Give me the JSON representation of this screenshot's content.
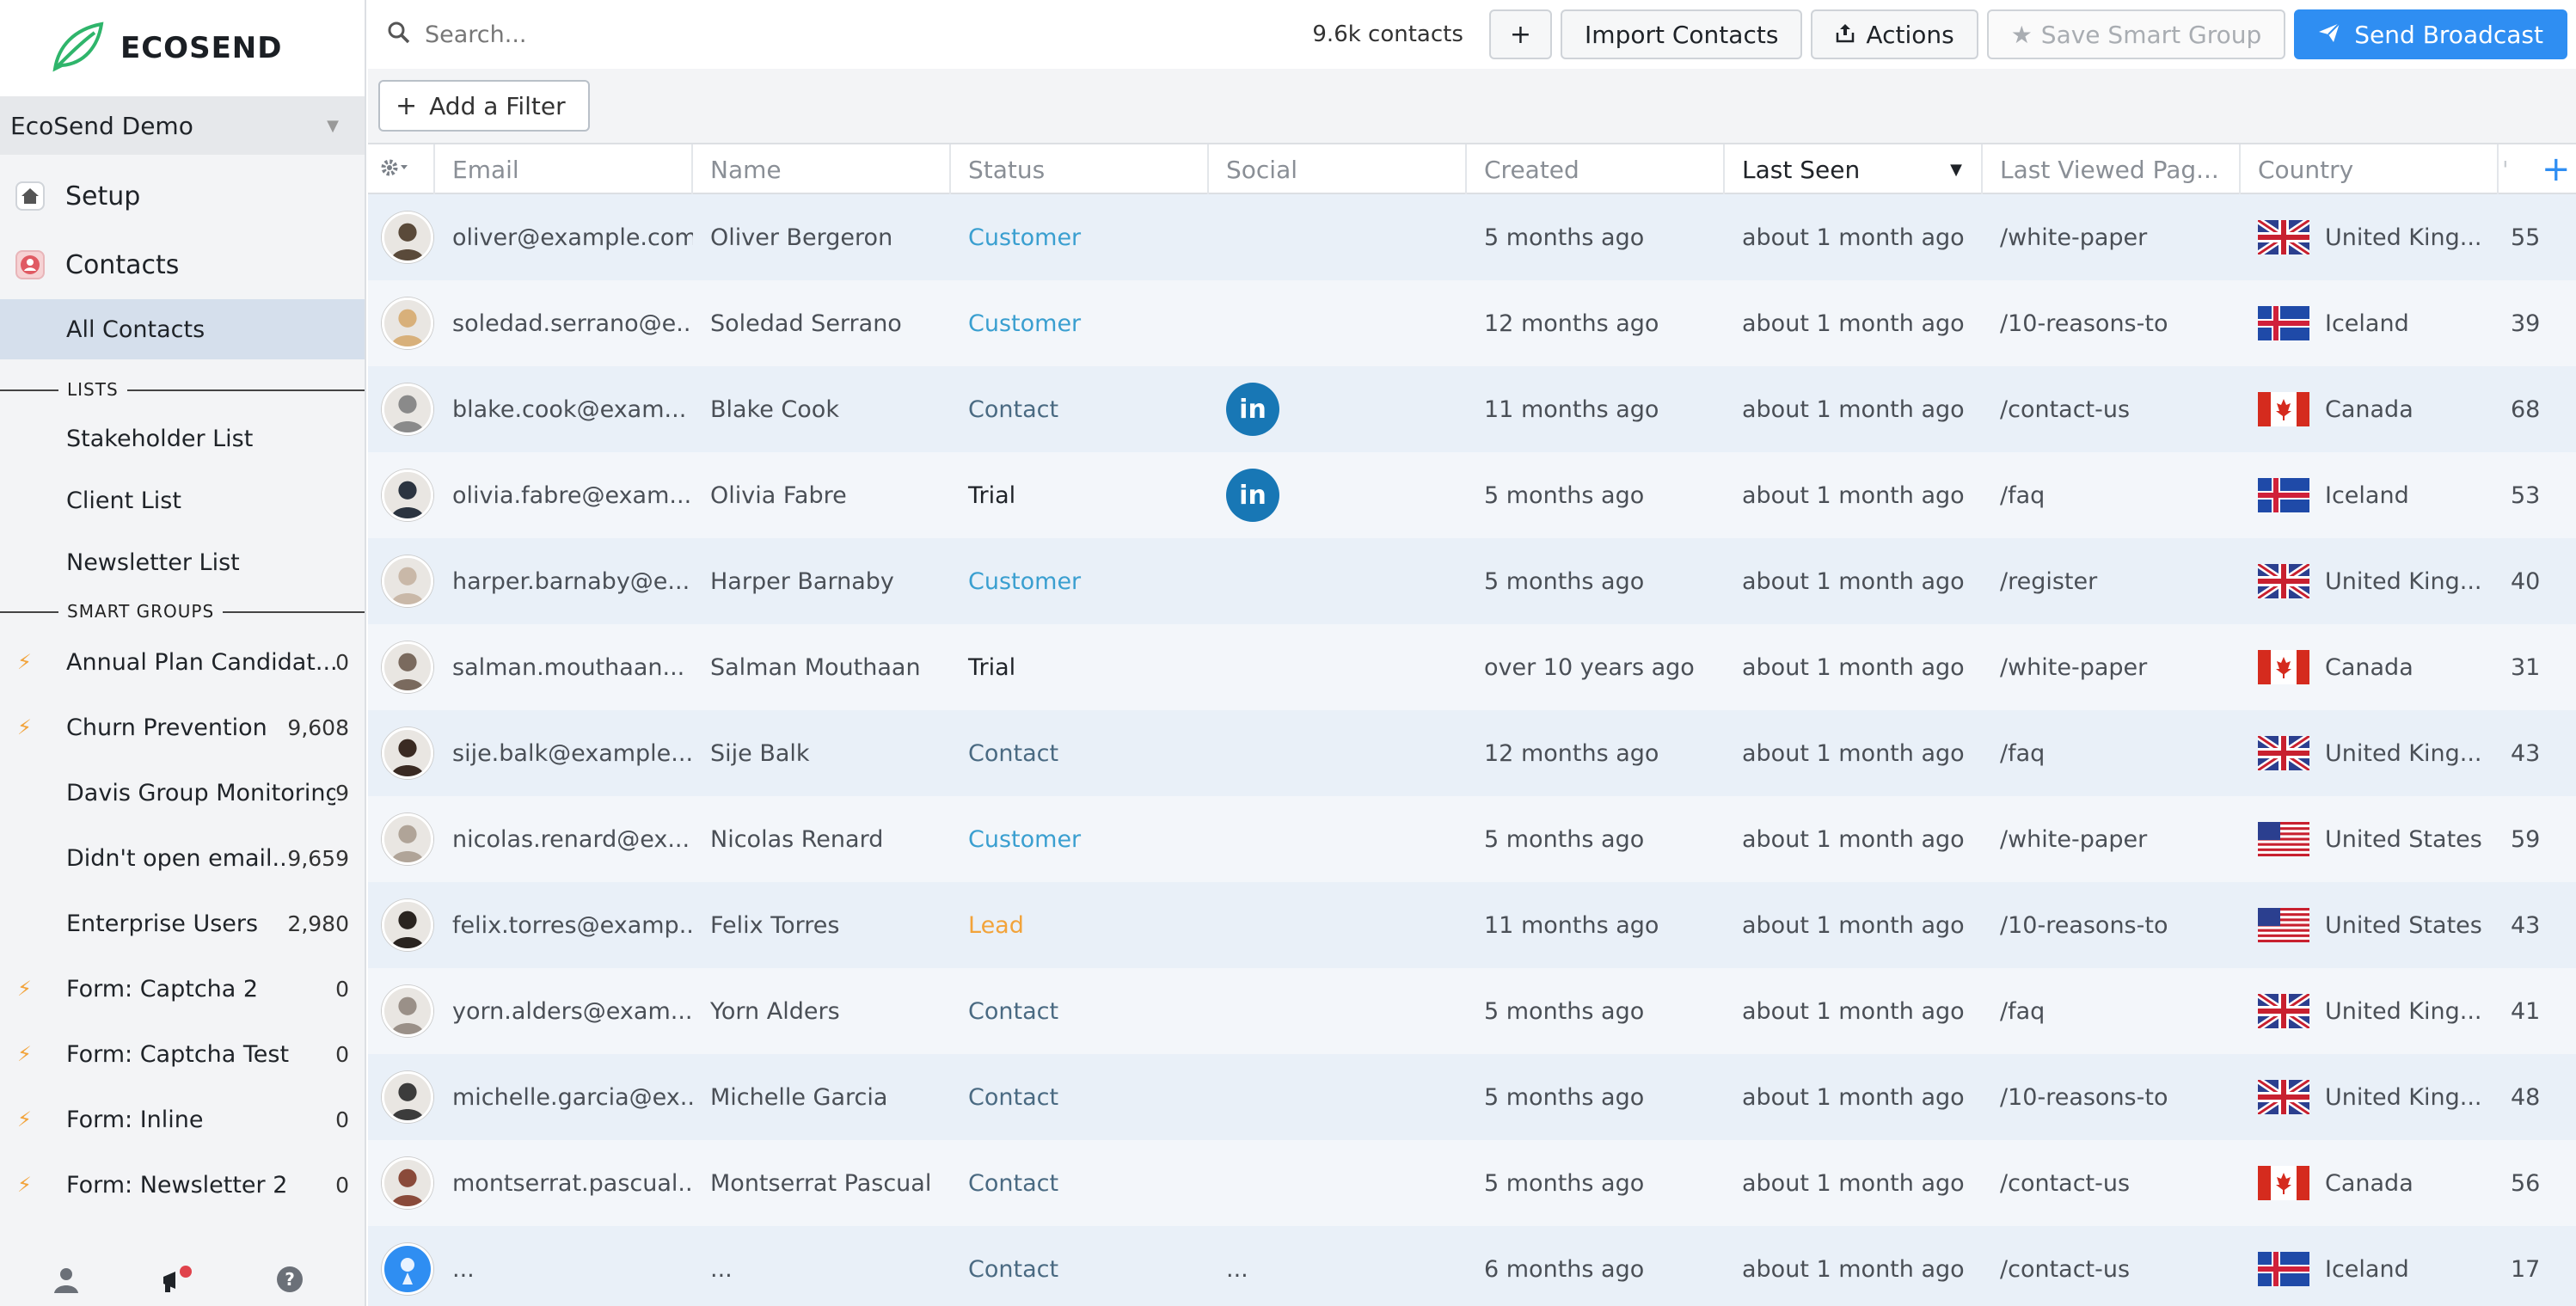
{
  "app": {
    "brand": "ECOSEND",
    "workspace": "EcoSend Demo"
  },
  "sidebar": {
    "nav": [
      {
        "label": "Setup",
        "icon": "house-icon"
      },
      {
        "label": "Contacts",
        "icon": "contacts-icon"
      }
    ],
    "all_contacts": "All Contacts",
    "lists_heading": "LISTS",
    "lists": [
      "Stakeholder List",
      "Client List",
      "Newsletter List"
    ],
    "smart_groups_heading": "SMART GROUPS",
    "smart_groups": [
      {
        "name": "Annual Plan Candidat...",
        "count": "0",
        "bolt": true
      },
      {
        "name": "Churn Prevention",
        "count": "9,608",
        "bolt": true
      },
      {
        "name": "Davis Group Monitoring",
        "count": "9",
        "bolt": false
      },
      {
        "name": "Didn't open email...",
        "count": "9,659",
        "bolt": false
      },
      {
        "name": "Enterprise Users",
        "count": "2,980",
        "bolt": false
      },
      {
        "name": "Form: Captcha 2",
        "count": "0",
        "bolt": true
      },
      {
        "name": "Form: Captcha Test",
        "count": "0",
        "bolt": true
      },
      {
        "name": "Form: Inline",
        "count": "0",
        "bolt": true
      },
      {
        "name": "Form: Newsletter 2",
        "count": "0",
        "bolt": true
      }
    ]
  },
  "topbar": {
    "search_placeholder": "Search...",
    "contact_count": "9.6k contacts",
    "add_label": "+",
    "import_label": "Import Contacts",
    "actions_label": "Actions",
    "save_smart_group_label": "Save Smart Group",
    "send_broadcast_label": "Send Broadcast"
  },
  "filterbar": {
    "add_filter_label": "Add a Filter"
  },
  "table": {
    "columns": [
      "Email",
      "Name",
      "Status",
      "Social",
      "Created",
      "Last Seen",
      "Last Viewed Pag...",
      "Country"
    ],
    "status_colors": {
      "Customer": "#3a9fd0",
      "Contact": "#4a6a82",
      "Trial": "#1f2328",
      "Lead": "#f2a33a"
    },
    "rows": [
      {
        "email": "oliver@example.com",
        "name": "Oliver Bergeron",
        "status": "Customer",
        "social": "",
        "created": "5 months ago",
        "last_seen": "about 1 month ago",
        "page": "/white-paper",
        "country": "United King...",
        "flag": "uk",
        "num": "55",
        "avatar": "#5a4a3a"
      },
      {
        "email": "soledad.serrano@e...",
        "name": "Soledad Serrano",
        "status": "Customer",
        "social": "",
        "created": "12 months ago",
        "last_seen": "about 1 month ago",
        "page": "/10-reasons-to",
        "country": "Iceland",
        "flag": "is",
        "num": "39",
        "avatar": "#d8b07a"
      },
      {
        "email": "blake.cook@exam...",
        "name": "Blake Cook",
        "status": "Contact",
        "social": "in",
        "created": "11 months ago",
        "last_seen": "about 1 month ago",
        "page": "/contact-us",
        "country": "Canada",
        "flag": "ca",
        "num": "68",
        "avatar": "#8a8a8a"
      },
      {
        "email": "olivia.fabre@exam...",
        "name": "Olivia Fabre",
        "status": "Trial",
        "social": "in",
        "created": "5 months ago",
        "last_seen": "about 1 month ago",
        "page": "/faq",
        "country": "Iceland",
        "flag": "is",
        "num": "53",
        "avatar": "#2b3440"
      },
      {
        "email": "harper.barnaby@e...",
        "name": "Harper Barnaby",
        "status": "Customer",
        "social": "",
        "created": "5 months ago",
        "last_seen": "about 1 month ago",
        "page": "/register",
        "country": "United King...",
        "flag": "uk",
        "num": "40",
        "avatar": "#c9b8a8"
      },
      {
        "email": "salman.mouthaan...",
        "name": "Salman Mouthaan",
        "status": "Trial",
        "social": "",
        "created": "over 10 years ago",
        "last_seen": "about 1 month ago",
        "page": "/white-paper",
        "country": "Canada",
        "flag": "ca",
        "num": "31",
        "avatar": "#7a6a5e"
      },
      {
        "email": "sije.balk@example....",
        "name": "Sije Balk",
        "status": "Contact",
        "social": "",
        "created": "12 months ago",
        "last_seen": "about 1 month ago",
        "page": "/faq",
        "country": "United King...",
        "flag": "uk",
        "num": "43",
        "avatar": "#3a2a22"
      },
      {
        "email": "nicolas.renard@ex...",
        "name": "Nicolas Renard",
        "status": "Customer",
        "social": "",
        "created": "5 months ago",
        "last_seen": "about 1 month ago",
        "page": "/white-paper",
        "country": "United States",
        "flag": "us",
        "num": "59",
        "avatar": "#b0a498"
      },
      {
        "email": "felix.torres@examp...",
        "name": "Felix Torres",
        "status": "Lead",
        "social": "",
        "created": "11 months ago",
        "last_seen": "about 1 month ago",
        "page": "/10-reasons-to",
        "country": "United States",
        "flag": "us",
        "num": "43",
        "avatar": "#2a2420"
      },
      {
        "email": "yorn.alders@exam...",
        "name": "Yorn Alders",
        "status": "Contact",
        "social": "",
        "created": "5 months ago",
        "last_seen": "about 1 month ago",
        "page": "/faq",
        "country": "United King...",
        "flag": "uk",
        "num": "41",
        "avatar": "#9a9088"
      },
      {
        "email": "michelle.garcia@ex...",
        "name": "Michelle Garcia",
        "status": "Contact",
        "social": "",
        "created": "5 months ago",
        "last_seen": "about 1 month ago",
        "page": "/10-reasons-to",
        "country": "United King...",
        "flag": "uk",
        "num": "48",
        "avatar": "#3c3c3c"
      },
      {
        "email": "montserrat.pascual...",
        "name": "Montserrat Pascual",
        "status": "Contact",
        "social": "",
        "created": "5 months ago",
        "last_seen": "about 1 month ago",
        "page": "/contact-us",
        "country": "Canada",
        "flag": "ca",
        "num": "56",
        "avatar": "#8a4a3a"
      },
      {
        "email": "...",
        "name": "...",
        "status": "Contact",
        "social": "...",
        "created": "6 months ago",
        "last_seen": "about 1 month ago",
        "page": "/contact-us",
        "country": "Iceland",
        "flag": "is",
        "num": "17",
        "avatar": "#2f8ef2"
      }
    ]
  }
}
